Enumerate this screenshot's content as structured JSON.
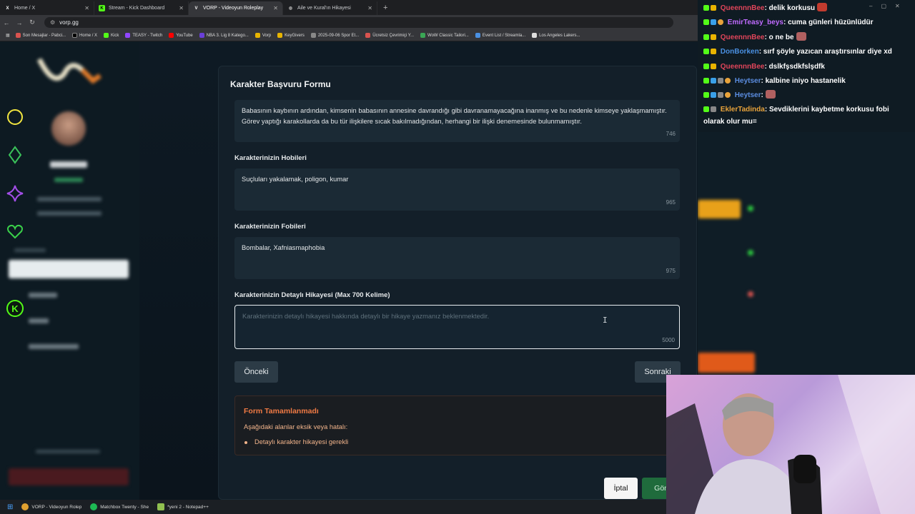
{
  "browser": {
    "tabs": [
      {
        "title": "Home / X",
        "icon": "x-logo-icon",
        "active": false
      },
      {
        "title": "Stream - Kick Dashboard",
        "icon": "kick-logo-icon",
        "active": false
      },
      {
        "title": "VORP - Videoyun Roleplay",
        "icon": "vorp-logo-icon",
        "active": true
      },
      {
        "title": "Aile ve Kural'ın Hikayesi",
        "icon": "globe-icon",
        "active": false
      }
    ],
    "url": "vorp.gg",
    "bookmarks": [
      "Son Mesajlar - Pabci...",
      "Home / X",
      "Kick",
      "TEASY - Twitch",
      "YouTube",
      "NBA 3. Lig 8 Katego...",
      "Vorp",
      "KeyGivers",
      "2025-09-06 Spor Et...",
      "Ücretsiz Çevrimiçi Y...",
      "WoW Classic Tailori...",
      "Event List / Streamla...",
      "Los Angeles Lakers..."
    ]
  },
  "form": {
    "title": "Karakter Başvuru Formu",
    "background_text": "Babasının kaybının ardından, kimsenin babasının annesine davrandığı gibi davranamayacağına inanmış ve bu nedenle kimseye yaklaşmamıştır. Görev yaptığı karakollarda da bu tür ilişkilere sıcak bakılmadığından, herhangi bir ilişki denemesinde bulunmamıştır.",
    "background_count": "746",
    "hobbies_label": "Karakterinizin Hobileri",
    "hobbies_value": "Suçluları yakalamak, poligon, kumar",
    "hobbies_count": "965",
    "phobias_label": "Karakterinizin Fobileri",
    "phobias_value": "Bombalar, Xafniasmaphobia",
    "phobias_count": "975",
    "story_label": "Karakterinizin Detaylı Hikayesi (Max 700 Kelime)",
    "story_placeholder": "Karakterinizin detaylı hikayesi hakkında detaylı bir hikaye yazmanız beklenmektedir.",
    "story_count": "5000",
    "prev_button": "Önceki",
    "next_button": "Sonraki",
    "error_title": "Form Tamamlanmadı",
    "error_subtitle": "Aşağıdaki alanlar eksik veya hatalı:",
    "error_item": "Detaylı karakter hikayesi gerekli",
    "cancel_button": "İptal",
    "submit_button": "Gönd"
  },
  "chat": {
    "messages": [
      {
        "user": "QueennnBee",
        "color": "#e0455a",
        "text": ": delik korkusu",
        "emote": true
      },
      {
        "user": "EmirTeasy_beys",
        "color": "#c06bff",
        "text": ": cuma günleri hüzünlüdür",
        "emote": false
      },
      {
        "user": "QueennnBee",
        "color": "#e0455a",
        "text": ": o ne be",
        "emote": true
      },
      {
        "user": "DonBorken",
        "color": "#4a90e2",
        "text": ": sırf şöyle yazıcan araştırsınlar diye xd",
        "emote": false
      },
      {
        "user": "QueennnBee",
        "color": "#e0455a",
        "text": ": dslkfşsdkfslşdfk",
        "emote": false
      },
      {
        "user": "Heytser",
        "color": "#5b8de0",
        "text": ": kalbine iniyo hastanelik",
        "emote": false
      },
      {
        "user": "Heytser",
        "color": "#5b8de0",
        "text": ":",
        "emote": true
      },
      {
        "user": "EklerTadinda",
        "color": "#e8a33b",
        "text": ": Sevdiklerini kaybetme korkusu fobi olarak olur mu=",
        "emote": false
      }
    ]
  },
  "taskbar": {
    "items": [
      "VORP - Videoyun Rolep",
      "Matchbox Twenty - She",
      "*yeni 2 - Notepad++"
    ]
  },
  "colors": {
    "accent_green": "#53fc18",
    "error_orange": "#f07a44",
    "submit_green": "#1f6b3c"
  }
}
